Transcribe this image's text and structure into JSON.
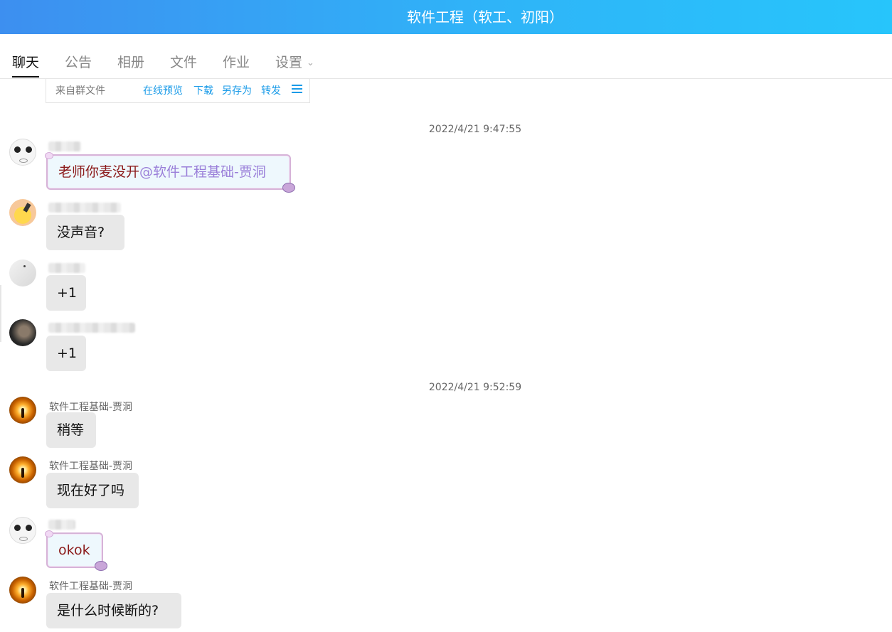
{
  "window": {
    "title": "软件工程（软工、初阳）"
  },
  "tabs": [
    {
      "label": "聊天",
      "active": true
    },
    {
      "label": "公告",
      "active": false
    },
    {
      "label": "相册",
      "active": false
    },
    {
      "label": "文件",
      "active": false
    },
    {
      "label": "作业",
      "active": false
    },
    {
      "label": "设置",
      "active": false,
      "dropdown": true
    }
  ],
  "file_card": {
    "source": "来自群文件",
    "actions": [
      "在线预览",
      "下载",
      "另存为",
      "转发"
    ],
    "menu_icon": "hamburger-icon"
  },
  "timestamps": [
    "2022/4/21 9:47:55",
    "2022/4/21 9:52:59"
  ],
  "messages": [
    {
      "sender": "",
      "sender_hidden": true,
      "text": "老师你麦没开",
      "mention": "@软件工程基础-贾洞",
      "style": "fancy"
    },
    {
      "sender": "",
      "sender_hidden": true,
      "text": "没声音?",
      "style": "plain"
    },
    {
      "sender": "",
      "sender_hidden": true,
      "text": "+1",
      "style": "plain"
    },
    {
      "sender": "",
      "sender_hidden": true,
      "text": "+1",
      "style": "plain"
    },
    {
      "sender": "软件工程基础-贾洞",
      "text": "稍等",
      "style": "plain"
    },
    {
      "sender": "软件工程基础-贾洞",
      "text": "现在好了吗",
      "style": "plain"
    },
    {
      "sender": "",
      "sender_hidden": true,
      "text": "okok",
      "style": "fancy"
    },
    {
      "sender": "软件工程基础-贾洞",
      "text": "是什么时候断的?",
      "style": "plain"
    }
  ],
  "colors": {
    "header_start": "#3d8ff0",
    "header_end": "#27c5fb",
    "link": "#1a9be8",
    "bubble": "#e8e8e8"
  }
}
